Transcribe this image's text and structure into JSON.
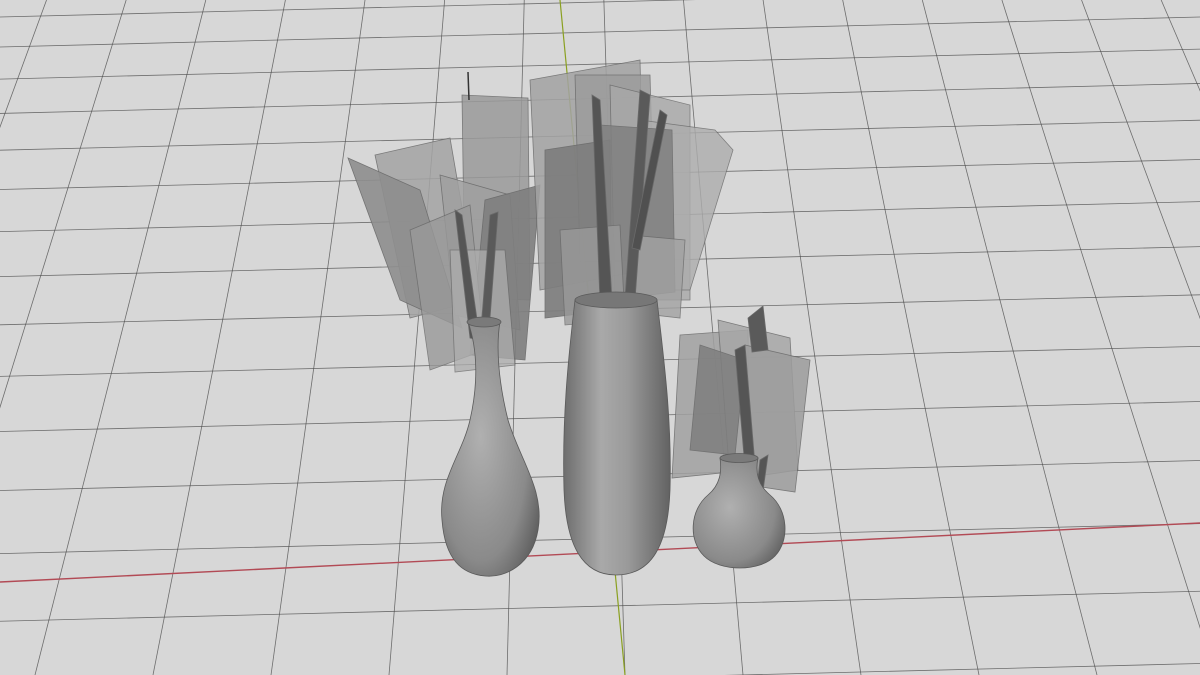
{
  "viewport": {
    "background": "#d7d7d7",
    "grid_line_color": "#4a4a4a",
    "x_axis_color": "#b24a55",
    "y_axis_color": "#8aa020"
  },
  "scene": {
    "objects": [
      {
        "name": "vase-left",
        "kind": "bulb-vase-with-card-bouquet",
        "material_color": "#8c8c8c"
      },
      {
        "name": "vase-center",
        "kind": "tall-cylinder-vase-with-card-bouquet",
        "material_color": "#8a8a8a"
      },
      {
        "name": "vase-right",
        "kind": "small-round-vase-with-card-bouquet",
        "material_color": "#909090"
      }
    ]
  }
}
